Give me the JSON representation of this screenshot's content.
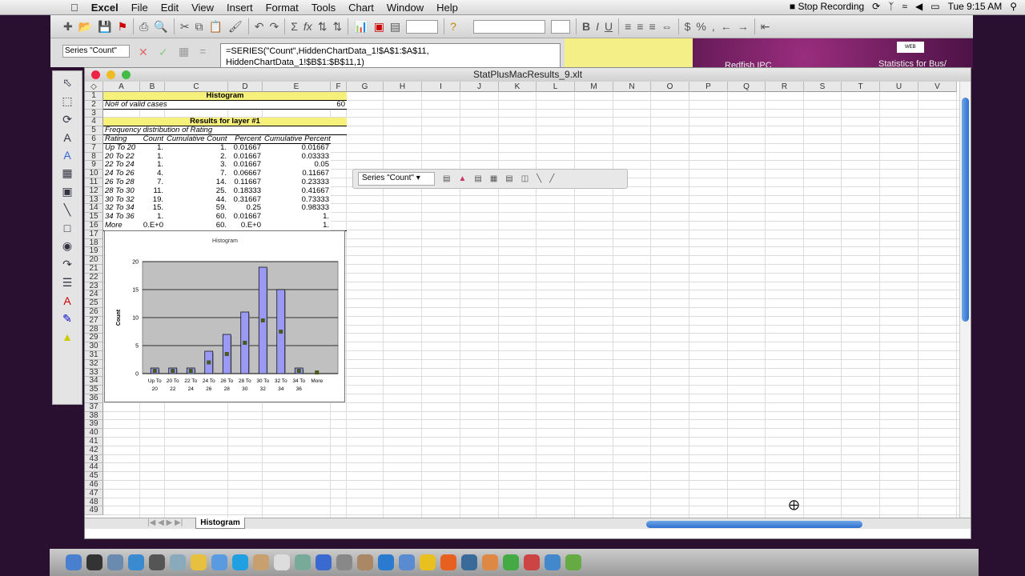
{
  "menubar": {
    "app": "Excel",
    "items": [
      "File",
      "Edit",
      "View",
      "Insert",
      "Format",
      "Tools",
      "Chart",
      "Window",
      "Help"
    ],
    "status": {
      "recording": "Stop Recording",
      "clock": "Tue 9:15 AM"
    }
  },
  "formula_bar": {
    "name_box": "Series \"Count\"",
    "formula": "=SERIES(\"Count\",HiddenChartData_1!$A$1:$A$11, HiddenChartData_1!$B$1:$B$11,1)"
  },
  "desktop": {
    "label1": "Redfish IPC",
    "label2": "Statistics for Bus/",
    "web": "WEB"
  },
  "window": {
    "title": "StatPlusMacResults_9.xlt"
  },
  "columns": [
    "A",
    "B",
    "C",
    "D",
    "E",
    "F",
    "G",
    "H",
    "I",
    "J",
    "K",
    "L",
    "M",
    "N",
    "O",
    "P",
    "Q",
    "R",
    "S",
    "T",
    "U",
    "V"
  ],
  "row_count": 49,
  "cells": {
    "r1": "Histogram",
    "r2": {
      "A": "No# of valid cases",
      "F": "60"
    },
    "r4": "Results for layer #1",
    "r5": "Frequency distribution of Rating",
    "header": [
      "Rating",
      "Count",
      "Cumulative Count",
      "Percent",
      "Cumulative Percent"
    ],
    "rows": [
      [
        "Up To 20",
        "1.",
        "1.",
        "0.01667",
        "0.01667"
      ],
      [
        "20 To 22",
        "1.",
        "2.",
        "0.01667",
        "0.03333"
      ],
      [
        "22 To 24",
        "1.",
        "3.",
        "0.01667",
        "0.05"
      ],
      [
        "24 To 26",
        "4.",
        "7.",
        "0.06667",
        "0.11667"
      ],
      [
        "26 To 28",
        "7.",
        "14.",
        "0.11667",
        "0.23333"
      ],
      [
        "28 To 30",
        "11.",
        "25.",
        "0.18333",
        "0.41667"
      ],
      [
        "30 To 32",
        "19.",
        "44.",
        "0.31667",
        "0.73333"
      ],
      [
        "32 To 34",
        "15.",
        "59.",
        "0.25",
        "0.98333"
      ],
      [
        "34 To 36",
        "1.",
        "60.",
        "0.01667",
        "1."
      ],
      [
        "More",
        "0.E+0",
        "60.",
        "0.E+0",
        "1."
      ]
    ]
  },
  "chart_toolbar": {
    "selected": "Series \"Count\""
  },
  "sheet_tabs": [
    "Histogram"
  ],
  "chart_data": {
    "type": "bar",
    "title": "Histogram",
    "xlabel": "",
    "ylabel": "Count",
    "categories": [
      "Up To 20",
      "20 To 22",
      "22 To 24",
      "24 To 26",
      "26 To 28",
      "28 To 30",
      "30 To 32",
      "32 To 34",
      "34 To 36",
      "More"
    ],
    "series": [
      {
        "name": "Count",
        "values": [
          1,
          1,
          1,
          4,
          7,
          11,
          19,
          15,
          1,
          0
        ],
        "color": "#9a9af5"
      },
      {
        "type": "marker",
        "values": [
          0.5,
          0.5,
          0.5,
          2,
          3.5,
          5.5,
          9.5,
          7.5,
          0.5,
          0.2
        ],
        "color": "#4a5a1a"
      }
    ],
    "ylim": [
      0,
      20
    ],
    "yticks": [
      0,
      5,
      10,
      15,
      20
    ],
    "grid": true,
    "plot_bg": "#c0c0c0"
  },
  "colors": {
    "banner": "#f7f07a",
    "accent": "#2f6fd0"
  }
}
